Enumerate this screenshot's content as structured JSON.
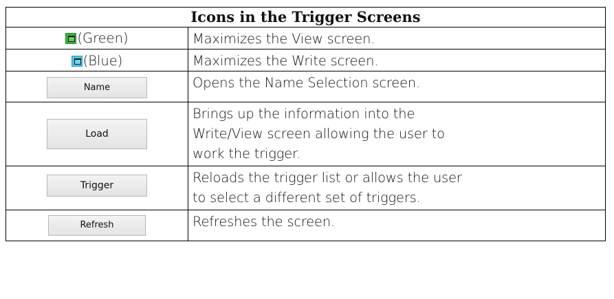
{
  "table": {
    "title": "Icons in the Trigger Screens",
    "rows": [
      {
        "icon_kind": "window-icon",
        "icon_color": "#3fb23f",
        "icon_label": "(Green)",
        "description": "Maximizes the View screen."
      },
      {
        "icon_kind": "window-icon",
        "icon_color": "#4fc3e6",
        "icon_label": "(Blue)",
        "description": "Maximizes the Write screen."
      },
      {
        "icon_kind": "button",
        "button_label": "Name",
        "description": "Opens the Name Selection screen."
      },
      {
        "icon_kind": "button",
        "button_label": "Load",
        "description_lines": [
          "Brings up the information into the",
          "Write/View screen allowing the user to",
          "work the trigger."
        ]
      },
      {
        "icon_kind": "button",
        "button_label": "Trigger",
        "description_lines": [
          "Reloads the trigger list or allows the user",
          "to select a different set of triggers."
        ]
      },
      {
        "icon_kind": "button",
        "button_label": "Refresh",
        "description": "Refreshes the screen."
      }
    ]
  }
}
